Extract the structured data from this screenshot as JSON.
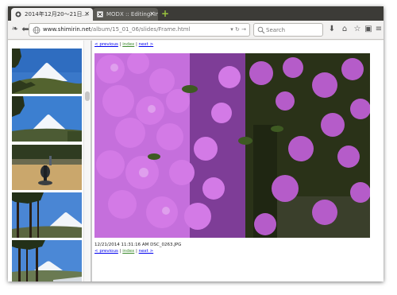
{
  "browser": {
    "tabs": [
      {
        "title": "2014年12月20〜21日…",
        "active": true
      },
      {
        "title": "MODX :: Editing: Ima…",
        "active": false
      }
    ],
    "url_domain": "www.shimirin.net",
    "url_path": "/album/15_01_06/slides/Frame.html",
    "search_placeholder": "Search"
  },
  "page": {
    "nav": {
      "previous": "< previous",
      "separator": "|",
      "index": "index",
      "next": "next >"
    },
    "caption": "12/21/2014 11:31:16 AM DSC_0263.JPG",
    "thumbnails": [
      {
        "subject": "mount-fuji"
      },
      {
        "subject": "mount-fuji"
      },
      {
        "subject": "tree-sculpture"
      },
      {
        "subject": "mount-fuji"
      },
      {
        "subject": "mount-fuji"
      }
    ],
    "main_image_subject": "bougainvillea-flowers"
  },
  "colors": {
    "tabstrip": "#3c3b37",
    "link": "#0000ee",
    "index_link": "#3c8a2e",
    "newtab_plus": "#9bc53d"
  }
}
